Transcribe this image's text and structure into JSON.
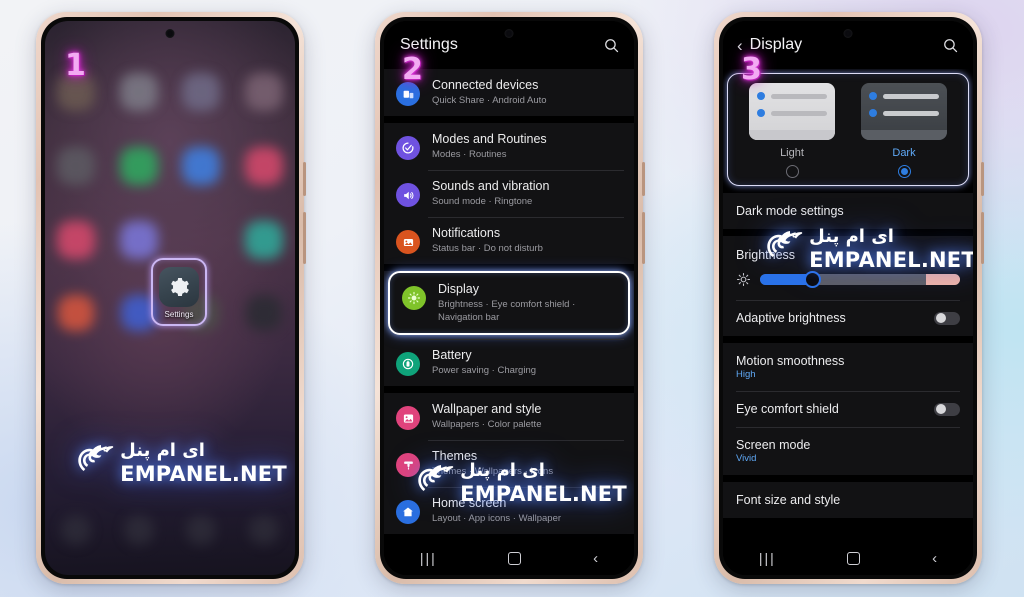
{
  "background": {
    "colors": [
      "#f2f3f6",
      "#dde7f6",
      "#cfe2f2",
      "#ddd4ef"
    ]
  },
  "watermark": {
    "persian": "ای ام پنل",
    "latin": "EMPANEL.NET",
    "glow_color": "#5a8cff"
  },
  "steps": {
    "one": "1",
    "two": "2",
    "three": "3",
    "color": "#f3aaf3"
  },
  "phone1": {
    "step": "1",
    "highlighted_app": {
      "label": "Settings",
      "icon": "gear-icon",
      "highlight_color": "#cbb7f3"
    },
    "app_rows": [
      {
        "icons": [
          "#6b5a52",
          "#7c7a86",
          "#6f6a86",
          "#7a6272"
        ]
      },
      {
        "icons": [
          "#5c5a62",
          "#2fa85f",
          "#3f7fe0",
          "#d4486b"
        ]
      },
      {
        "icons": [
          "#d4486b",
          "#7a76d8",
          "#3f9fc0",
          "#2fa899"
        ]
      },
      {
        "icons": [
          "#d4553e",
          "#3f5fd0",
          "#4d4f4a",
          "#000000"
        ]
      }
    ],
    "dock": {
      "icons": [
        "#4a4a52",
        "#4a4a52",
        "#4a4a52",
        "#4a4a52"
      ]
    }
  },
  "phone2": {
    "step": "2",
    "header": {
      "title": "Settings",
      "search_icon": "search-icon"
    },
    "groups": [
      {
        "items": [
          {
            "title": "Connected devices",
            "subtitle": "Quick Share  ·  Android Auto",
            "icon": "connected-devices-icon",
            "color": "#2a6fe0",
            "highlighted": false
          }
        ]
      },
      {
        "items": [
          {
            "title": "Modes and Routines",
            "subtitle": "Modes  ·  Routines",
            "icon": "modes-routines-icon",
            "color": "#6f52e0",
            "highlighted": false
          },
          {
            "title": "Sounds and vibration",
            "subtitle": "Sound mode  ·  Ringtone",
            "icon": "sound-icon",
            "color": "#6f52e0",
            "highlighted": false
          },
          {
            "title": "Notifications",
            "subtitle": "Status bar  ·  Do not disturb",
            "icon": "notifications-icon",
            "color": "#d9541f",
            "highlighted": false
          }
        ]
      },
      {
        "items": [
          {
            "title": "Display",
            "subtitle": "Brightness  ·  Eye comfort shield  ·  Navigation bar",
            "icon": "display-icon",
            "color": "#7fc32a",
            "highlighted": true
          },
          {
            "title": "Battery",
            "subtitle": "Power saving  ·  Charging",
            "icon": "battery-icon",
            "color": "#0fa37a",
            "highlighted": false
          }
        ]
      },
      {
        "items": [
          {
            "title": "Wallpaper and style",
            "subtitle": "Wallpapers  ·  Color palette",
            "icon": "wallpaper-icon",
            "color": "#e0437c",
            "highlighted": false
          },
          {
            "title": "Themes",
            "subtitle": "Themes  ·  Wallpapers  ·  Icons",
            "icon": "themes-icon",
            "color": "#e0437c",
            "highlighted": false
          },
          {
            "title": "Home screen",
            "subtitle": "Layout  ·  App icons  ·  Wallpaper",
            "icon": "home-screen-icon",
            "color": "#2a6fe0",
            "highlighted": false
          }
        ]
      }
    ],
    "navbar": {
      "recent": "recent-apps-icon",
      "home": "home-icon",
      "back": "back-icon"
    }
  },
  "phone3": {
    "step": "3",
    "header": {
      "back": "back-chevron-icon",
      "title": "Display",
      "search_icon": "search-icon"
    },
    "mode_selector": {
      "options": [
        {
          "label": "Light",
          "selected": false
        },
        {
          "label": "Dark",
          "selected": true
        }
      ],
      "accent": "#2e7de0"
    },
    "rows": [
      {
        "title": "Dark mode settings",
        "subtitle": "",
        "control": "none"
      },
      {
        "title": "Brightness",
        "subtitle": "",
        "control": "slider",
        "slider": {
          "value": 24,
          "min": 0,
          "max": 100,
          "fill_color": "#2a72e8",
          "warm_color": "#efb3a6"
        }
      },
      {
        "title": "Adaptive brightness",
        "subtitle": "",
        "control": "toggle",
        "toggle_on": false
      },
      {
        "title": "Motion smoothness",
        "subtitle": "High",
        "control": "none"
      },
      {
        "title": "Eye comfort shield",
        "subtitle": "",
        "control": "toggle",
        "toggle_on": false
      },
      {
        "title": "Screen mode",
        "subtitle": "Vivid",
        "control": "none"
      },
      {
        "title": "Font size and style",
        "subtitle": "",
        "control": "none"
      }
    ],
    "navbar": {
      "recent": "recent-apps-icon",
      "home": "home-icon",
      "back": "back-icon"
    }
  }
}
